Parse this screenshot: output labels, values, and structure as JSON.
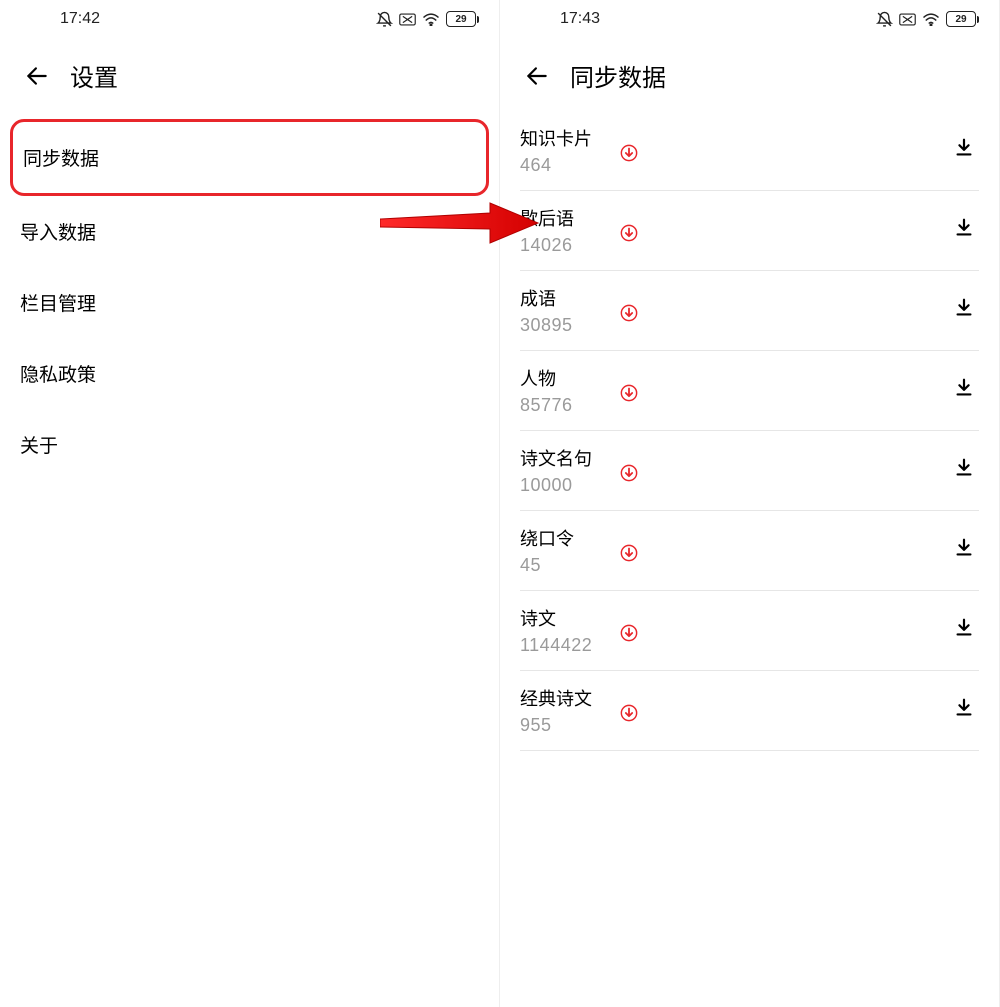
{
  "left_pane": {
    "status": {
      "time": "17:42",
      "battery": "29"
    },
    "title": "设置",
    "menu": [
      {
        "label": "同步数据",
        "highlighted": true,
        "name": "settings-item-sync"
      },
      {
        "label": "导入数据",
        "highlighted": false,
        "name": "settings-item-import"
      },
      {
        "label": "栏目管理",
        "highlighted": false,
        "name": "settings-item-columns"
      },
      {
        "label": "隐私政策",
        "highlighted": false,
        "name": "settings-item-privacy"
      },
      {
        "label": "关于",
        "highlighted": false,
        "name": "settings-item-about"
      }
    ]
  },
  "right_pane": {
    "status": {
      "time": "17:43",
      "battery": "29"
    },
    "title": "同步数据",
    "items": [
      {
        "name": "知识卡片",
        "count": "464"
      },
      {
        "name": "歇后语",
        "count": "14026"
      },
      {
        "name": "成语",
        "count": "30895"
      },
      {
        "name": "人物",
        "count": "85776"
      },
      {
        "name": "诗文名句",
        "count": "10000"
      },
      {
        "name": "绕口令",
        "count": "45"
      },
      {
        "name": "诗文",
        "count": "1144422"
      },
      {
        "name": "经典诗文",
        "count": "955"
      }
    ]
  },
  "colors": {
    "accent_red": "#e8262b",
    "muted": "#9a9a9a"
  }
}
